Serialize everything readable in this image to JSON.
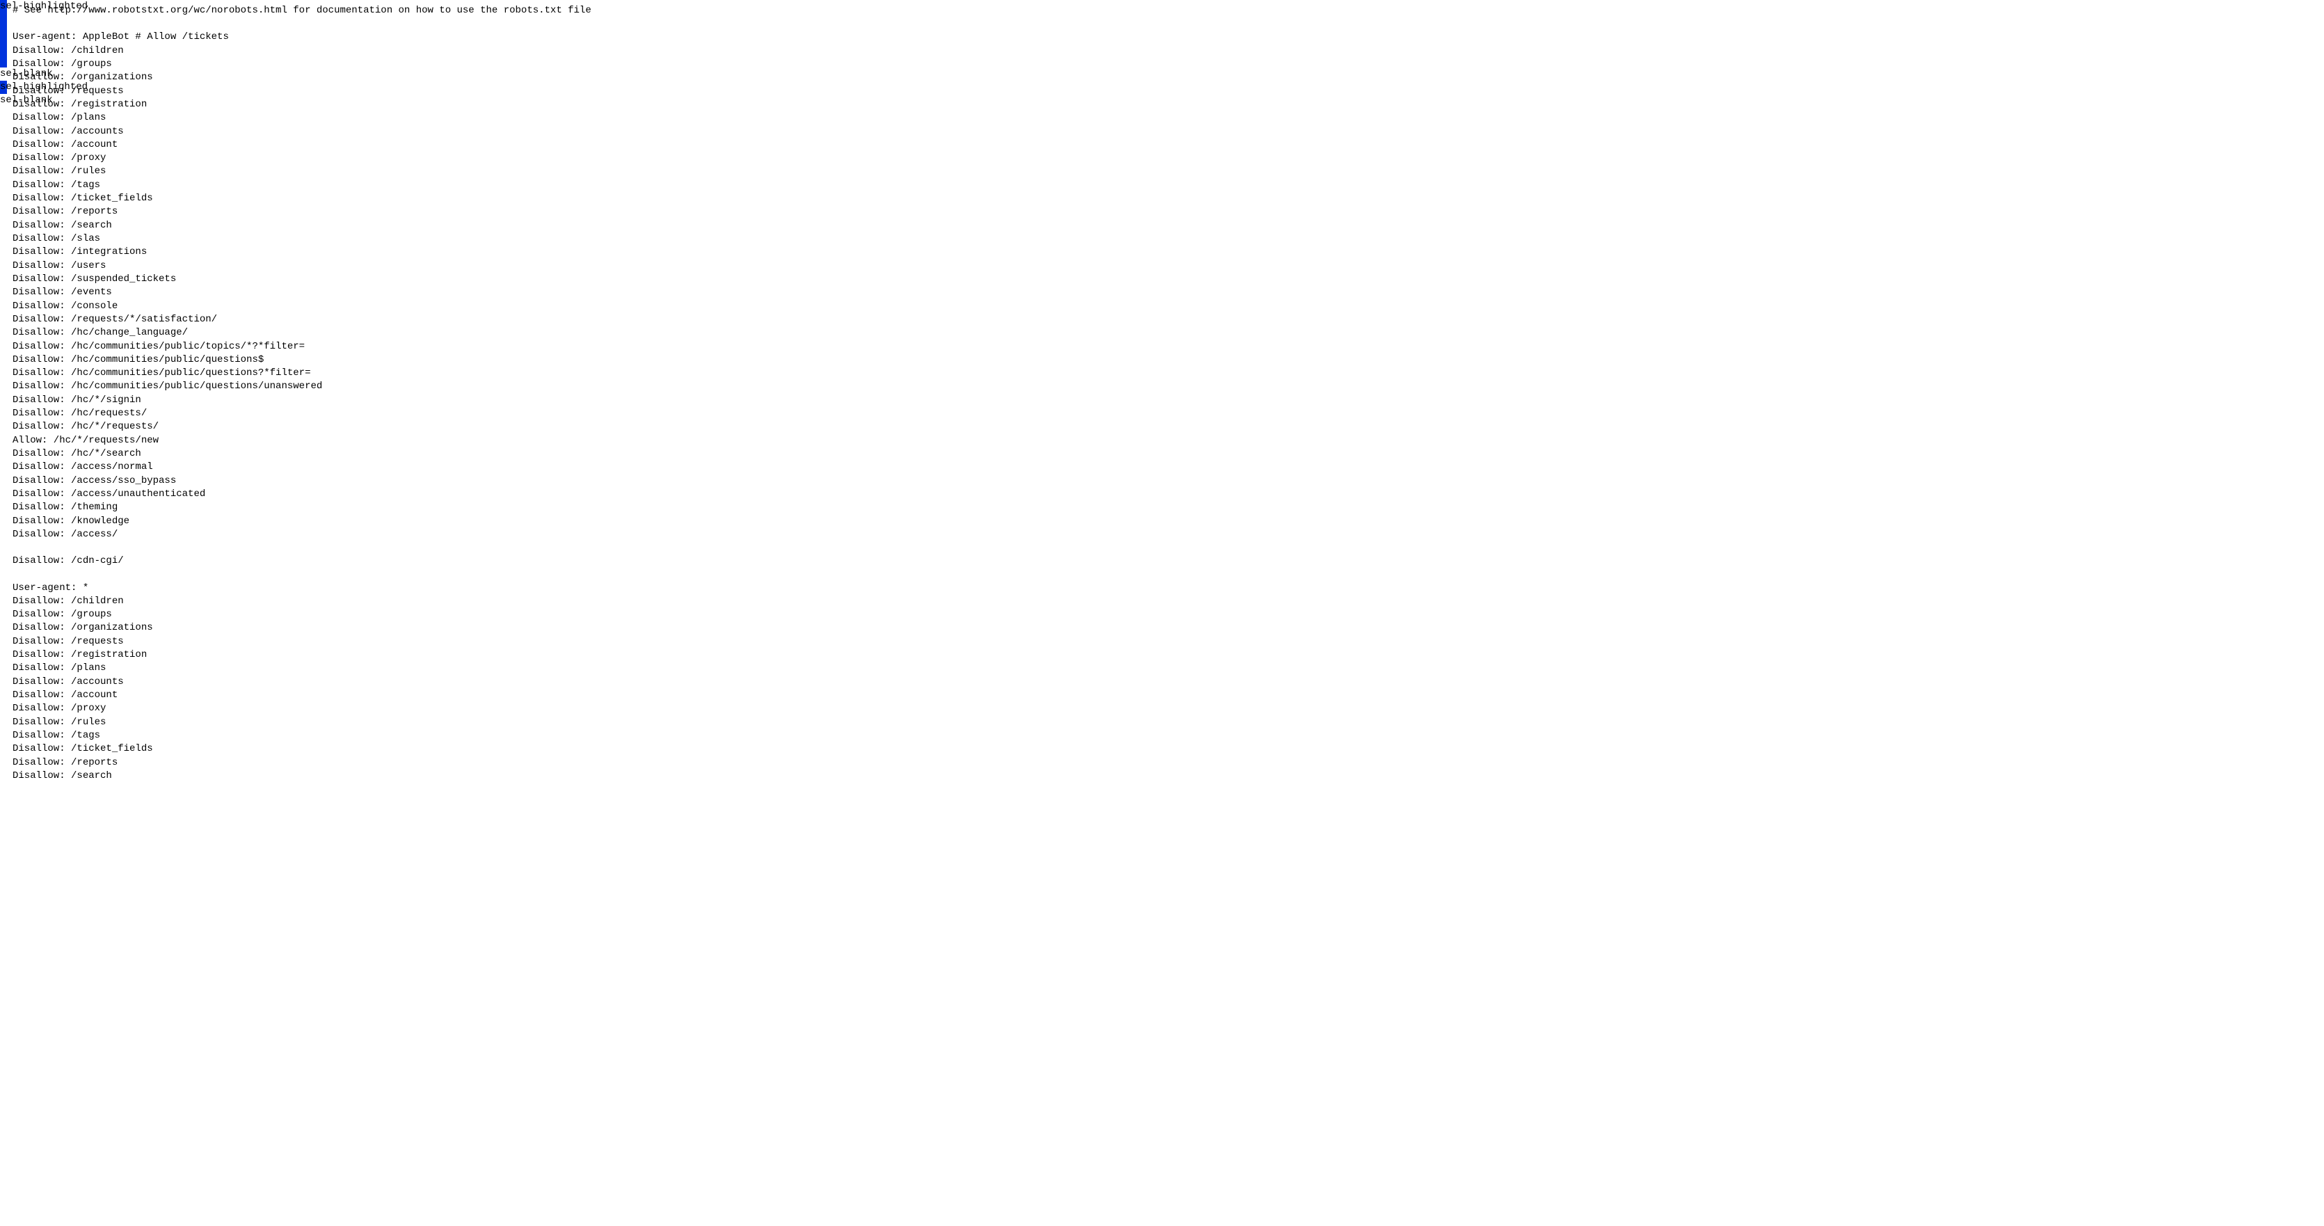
{
  "selection": {
    "segments": [
      {
        "class": "sel-highlighted",
        "lines": 5
      },
      {
        "class": "sel-blank",
        "lines": 1
      },
      {
        "class": "sel-highlighted",
        "lines": 1
      },
      {
        "class": "sel-blank",
        "lines": 52
      }
    ],
    "lineHeightPx": 19.3
  },
  "lines": [
    "# See http://www.robotstxt.org/wc/norobots.html for documentation on how to use the robots.txt file",
    "",
    "User-agent: AppleBot # Allow /tickets",
    "Disallow: /children",
    "Disallow: /groups",
    "Disallow: /organizations",
    "Disallow: /requests",
    "Disallow: /registration",
    "Disallow: /plans",
    "Disallow: /accounts",
    "Disallow: /account",
    "Disallow: /proxy",
    "Disallow: /rules",
    "Disallow: /tags",
    "Disallow: /ticket_fields",
    "Disallow: /reports",
    "Disallow: /search",
    "Disallow: /slas",
    "Disallow: /integrations",
    "Disallow: /users",
    "Disallow: /suspended_tickets",
    "Disallow: /events",
    "Disallow: /console",
    "Disallow: /requests/*/satisfaction/",
    "Disallow: /hc/change_language/",
    "Disallow: /hc/communities/public/topics/*?*filter=",
    "Disallow: /hc/communities/public/questions$",
    "Disallow: /hc/communities/public/questions?*filter=",
    "Disallow: /hc/communities/public/questions/unanswered",
    "Disallow: /hc/*/signin",
    "Disallow: /hc/requests/",
    "Disallow: /hc/*/requests/",
    "Allow: /hc/*/requests/new",
    "Disallow: /hc/*/search",
    "Disallow: /access/normal",
    "Disallow: /access/sso_bypass",
    "Disallow: /access/unauthenticated",
    "Disallow: /theming",
    "Disallow: /knowledge",
    "Disallow: /access/",
    "",
    "Disallow: /cdn-cgi/",
    "",
    "User-agent: *",
    "Disallow: /children",
    "Disallow: /groups",
    "Disallow: /organizations",
    "Disallow: /requests",
    "Disallow: /registration",
    "Disallow: /plans",
    "Disallow: /accounts",
    "Disallow: /account",
    "Disallow: /proxy",
    "Disallow: /rules",
    "Disallow: /tags",
    "Disallow: /ticket_fields",
    "Disallow: /reports",
    "Disallow: /search"
  ]
}
